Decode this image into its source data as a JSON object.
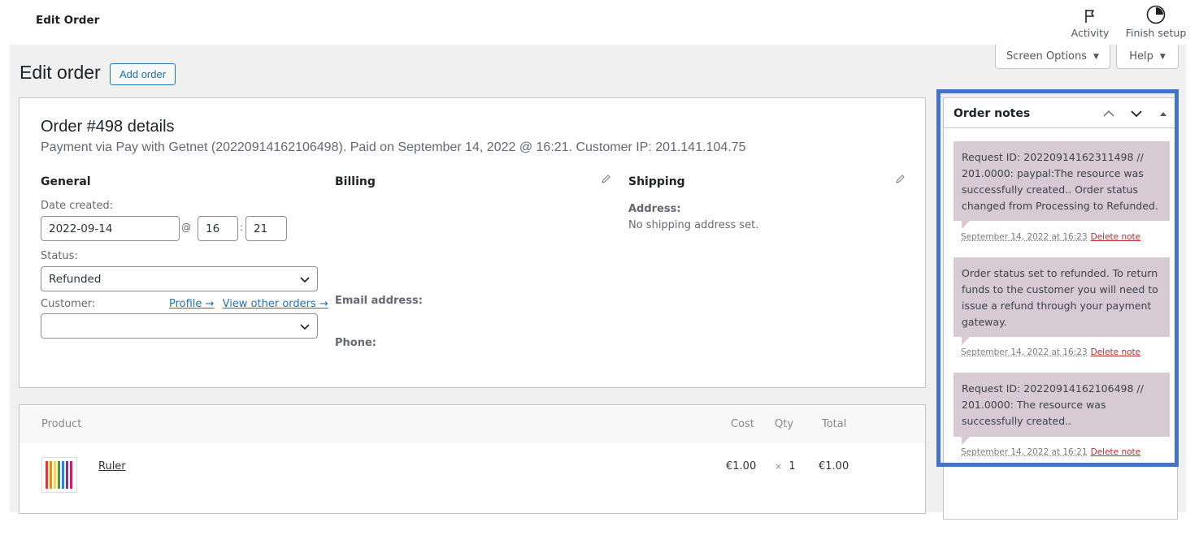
{
  "topbar": {
    "title": "Edit Order",
    "activity_label": "Activity",
    "finish_setup_label": "Finish setup"
  },
  "screen_options": {
    "label": "Screen Options",
    "arrow": "▼"
  },
  "help": {
    "label": "Help",
    "arrow": "▼"
  },
  "page": {
    "title": "Edit order",
    "add_order_label": "Add order"
  },
  "order": {
    "heading": "Order #498 details",
    "subtitle": "Payment via Pay with Getnet (20220914162106498). Paid on September 14, 2022 @ 16:21. Customer IP: 201.141.104.75",
    "general": {
      "heading": "General",
      "date_created_label": "Date created:",
      "date": "2022-09-14",
      "at": "@",
      "hour": "16",
      "colon": ":",
      "minute": "21",
      "status_label": "Status:",
      "status_value": "Refunded",
      "customer_label": "Customer:",
      "profile_link": "Profile →",
      "view_orders_link": "View other orders →",
      "customer_value": ""
    },
    "billing": {
      "heading": "Billing",
      "email_label": "Email address:",
      "phone_label": "Phone:"
    },
    "shipping": {
      "heading": "Shipping",
      "address_label": "Address:",
      "address_value": "No shipping address set."
    }
  },
  "items": {
    "headers": {
      "product": "Product",
      "cost": "Cost",
      "qty": "Qty",
      "total": "Total"
    },
    "rows": [
      {
        "name": "Ruler",
        "cost": "€1.00",
        "qty_prefix": "×",
        "qty": "1",
        "total": "€1.00"
      }
    ]
  },
  "notes": {
    "title": "Order notes",
    "delete_label": "Delete note",
    "entries": [
      {
        "text": "Request ID: 20220914162311498 // 201.0000: paypal:The resource was successfully created.. Order status changed from Processing to Refunded.",
        "date": "September 14, 2022 at 16:23"
      },
      {
        "text": "Order status set to refunded. To return funds to the customer you will need to issue a refund through your payment gateway.",
        "date": "September 14, 2022 at 16:23"
      },
      {
        "text": "Request ID: 20220914162106498 // 201.0000: The resource was successfully created..",
        "date": "September 14, 2022 at 16:21"
      }
    ]
  },
  "colors": {
    "accent": "#2271b1",
    "note_bg": "#d7cad2",
    "delete_red": "#b32d2e",
    "highlight": "#4472c4",
    "admin_bg": "#f0f0f1"
  }
}
